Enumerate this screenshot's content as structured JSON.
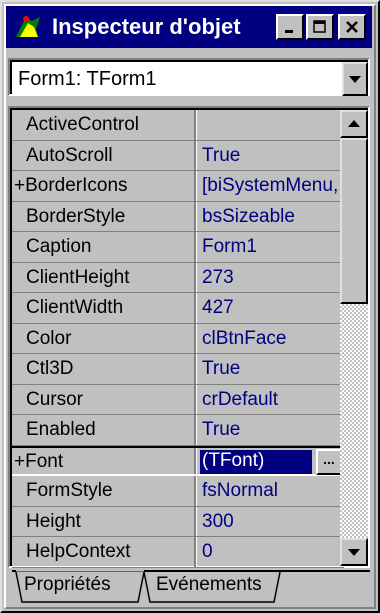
{
  "window": {
    "title": "Inspecteur d'objet",
    "buttons": [
      "minimize",
      "maximize",
      "close"
    ]
  },
  "object_selector": {
    "value": "Form1: TForm1"
  },
  "properties": [
    {
      "name": "ActiveControl",
      "value": "",
      "expandable": false
    },
    {
      "name": "AutoScroll",
      "value": "True",
      "expandable": false
    },
    {
      "name": "+BorderIcons",
      "value": "[biSystemMenu,",
      "expandable": true
    },
    {
      "name": "BorderStyle",
      "value": "bsSizeable",
      "expandable": false
    },
    {
      "name": "Caption",
      "value": "Form1",
      "expandable": false
    },
    {
      "name": "ClientHeight",
      "value": "273",
      "expandable": false
    },
    {
      "name": "ClientWidth",
      "value": "427",
      "expandable": false
    },
    {
      "name": "Color",
      "value": "clBtnFace",
      "expandable": false
    },
    {
      "name": "Ctl3D",
      "value": "True",
      "expandable": false
    },
    {
      "name": "Cursor",
      "value": "crDefault",
      "expandable": false
    },
    {
      "name": "Enabled",
      "value": "True",
      "expandable": false
    },
    {
      "name": "+Font",
      "value": "(TFont)",
      "expandable": true,
      "selected": true
    },
    {
      "name": "FormStyle",
      "value": "fsNormal",
      "expandable": false
    },
    {
      "name": "Height",
      "value": "300",
      "expandable": false
    },
    {
      "name": "HelpContext",
      "value": "0",
      "expandable": false
    }
  ],
  "ellipsis_label": "...",
  "tabs": {
    "active": "Propriétés",
    "inactive": "Evénements"
  },
  "colors": {
    "titlebar": "#000080",
    "value_text": "#000080",
    "face": "#c0c0c0"
  }
}
